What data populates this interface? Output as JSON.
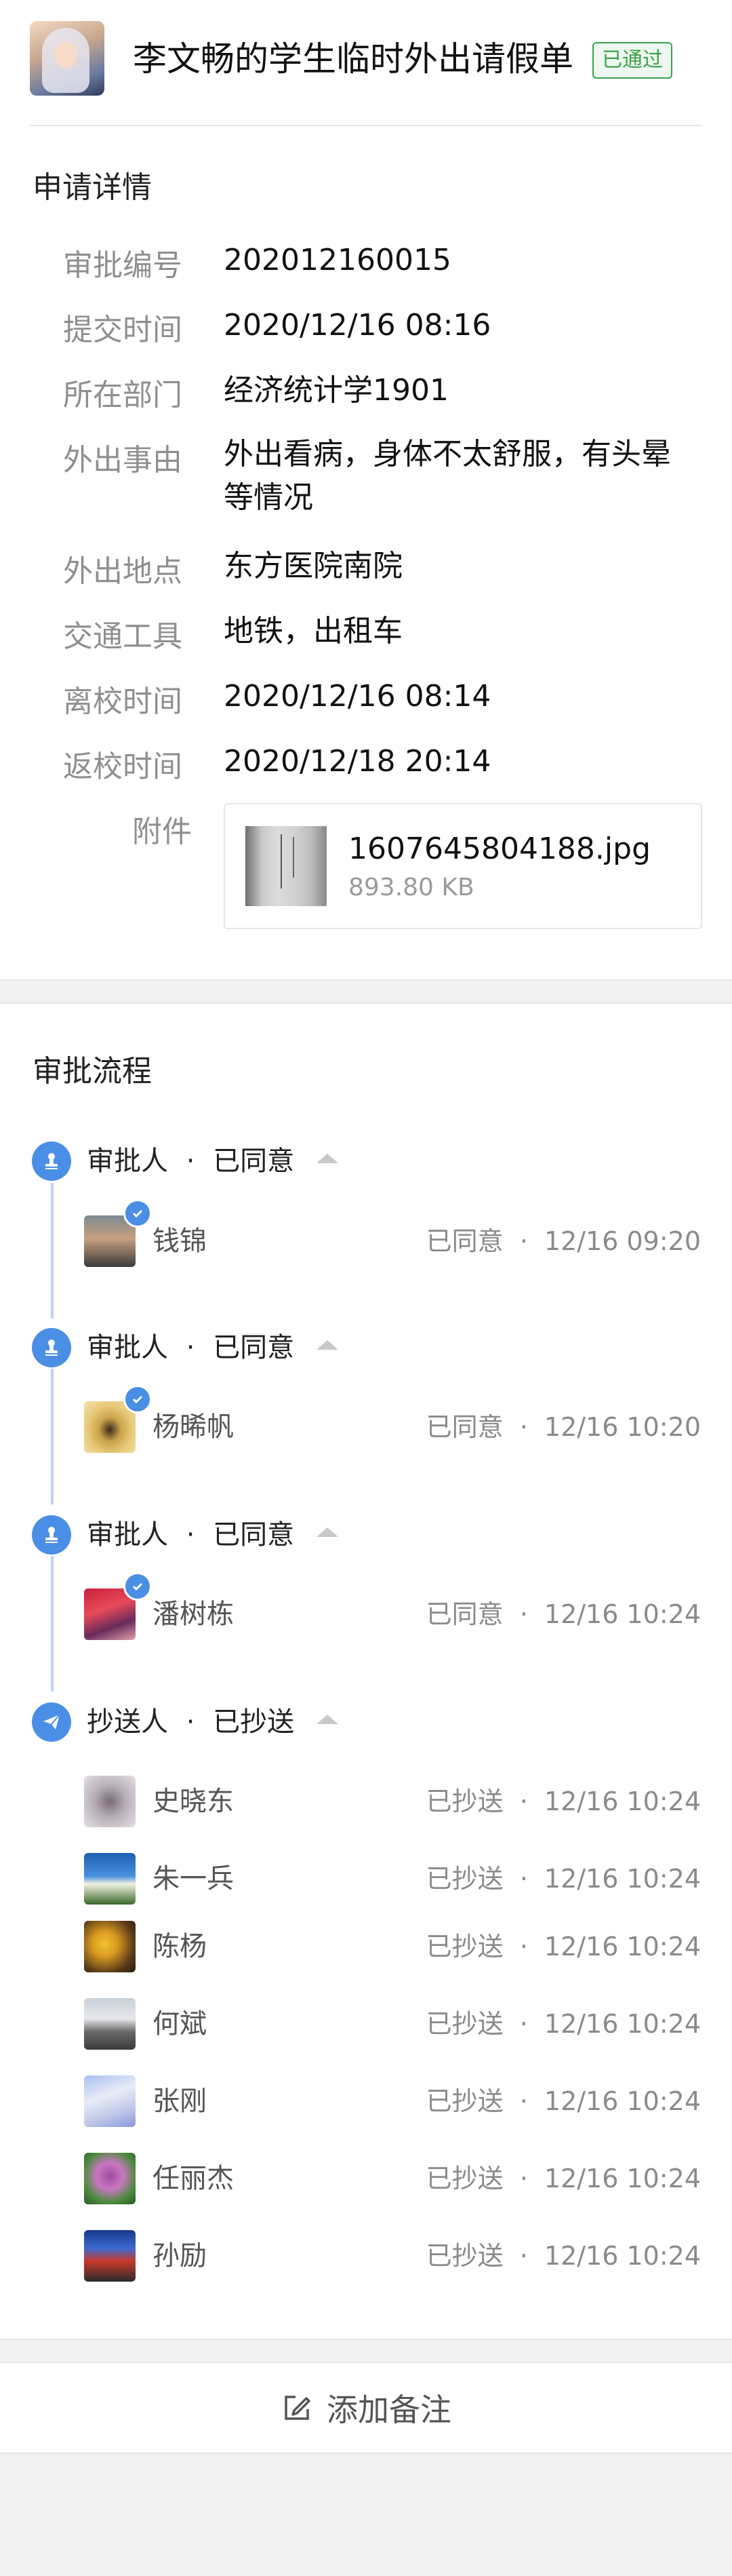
{
  "header": {
    "title": "李文畅的学生临时外出请假单",
    "badge": "已通过"
  },
  "details": {
    "section_title": "申请详情",
    "rows": [
      {
        "label": "审批编号",
        "value": "202012160015"
      },
      {
        "label": "提交时间",
        "value": "2020/12/16 08:16"
      },
      {
        "label": "所在部门",
        "value": "经济统计学1901"
      },
      {
        "label": "外出事由",
        "value": "外出看病，身体不太舒服，有头晕等情况"
      },
      {
        "label": "外出地点",
        "value": "东方医院南院"
      },
      {
        "label": "交通工具",
        "value": "地铁，出租车"
      },
      {
        "label": "离校时间",
        "value": "2020/12/16 08:14"
      },
      {
        "label": "返校时间",
        "value": "2020/12/18 20:14"
      }
    ],
    "attachment": {
      "label": "附件",
      "filename": "1607645804188.jpg",
      "size": "893.80 KB"
    }
  },
  "flow": {
    "section_title": "审批流程",
    "steps": [
      {
        "role": "审批人",
        "sep": "·",
        "state": "已同意",
        "icon": "stamp-icon",
        "people": [
          {
            "name": "钱锦",
            "status": "已同意",
            "time": "12/16 09:20"
          }
        ]
      },
      {
        "role": "审批人",
        "sep": "·",
        "state": "已同意",
        "icon": "stamp-icon",
        "people": [
          {
            "name": "杨晞帆",
            "status": "已同意",
            "time": "12/16 10:20"
          }
        ]
      },
      {
        "role": "审批人",
        "sep": "·",
        "state": "已同意",
        "icon": "stamp-icon",
        "people": [
          {
            "name": "潘树栋",
            "status": "已同意",
            "time": "12/16 10:24"
          }
        ]
      },
      {
        "role": "抄送人",
        "sep": "·",
        "state": "已抄送",
        "icon": "send-icon",
        "people": [
          {
            "name": "史晓东",
            "status": "已抄送",
            "time": "12/16 10:24"
          },
          {
            "name": "朱一兵",
            "status": "已抄送",
            "time": "12/16 10:24"
          },
          {
            "name": "陈杨",
            "status": "已抄送",
            "time": "12/16 10:24"
          },
          {
            "name": "何斌",
            "status": "已抄送",
            "time": "12/16 10:24"
          },
          {
            "name": "张刚",
            "status": "已抄送",
            "time": "12/16 10:24"
          },
          {
            "name": "任丽杰",
            "status": "已抄送",
            "time": "12/16 10:24"
          },
          {
            "name": "孙励",
            "status": "已抄送",
            "time": "12/16 10:24"
          }
        ]
      }
    ]
  },
  "footer": {
    "add_note_label": "添加备注"
  },
  "colors": {
    "accent_blue": "#4a8ee6",
    "approved_green": "#3aa34a"
  }
}
